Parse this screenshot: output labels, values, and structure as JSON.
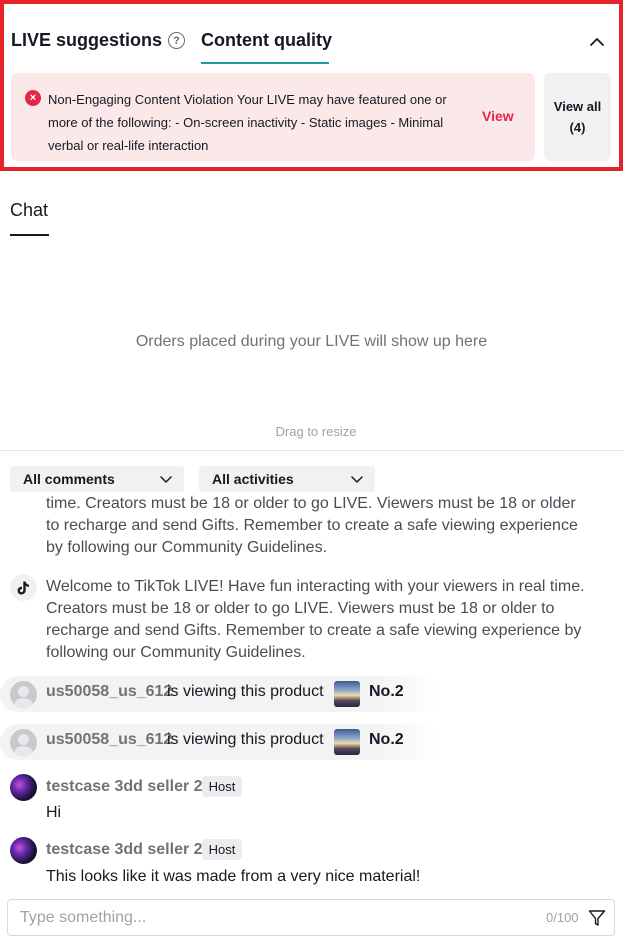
{
  "top_panel": {
    "tabs": [
      {
        "label": "LIVE suggestions",
        "help_icon": "question-circle-icon"
      },
      {
        "label": "Content quality",
        "active": true
      }
    ],
    "help_glyph": "?",
    "accent_color": "#1a9a9c",
    "highlight_color": "#e3242b",
    "violation": {
      "icon": "error-circle-icon",
      "icon_glyph": "×",
      "text": "Non-Engaging Content Violation Your LIVE may have featured one or more of the following: - On-screen inactivity - Static images - Minimal verbal or real-life interaction",
      "action_label": "View",
      "background": "#fbe9ea",
      "accent": "#e5264a"
    },
    "view_all": {
      "label": "View all",
      "count": "(4)"
    }
  },
  "chat": {
    "tab_label": "Chat",
    "empty_orders_text": "Orders placed during your LIVE will show up here",
    "drag_label": "Drag to resize",
    "filters": {
      "comments": "All comments",
      "activities": "All activities"
    },
    "system_message_partial": "time. Creators must be 18 or older to go LIVE. Viewers must be 18 or older to recharge and send Gifts. Remember to create a safe viewing experience by following our Community Guidelines.",
    "system_message": "Welcome to TikTok LIVE! Have fun interacting with your viewers in real time. Creators must be 18 or older to go LIVE. Viewers must be 18 or older to recharge and send Gifts. Remember to create a safe viewing experience by following our Community Guidelines.",
    "product_views": [
      {
        "user": "us50058_us_612",
        "action": "is viewing this product",
        "product": "No.2"
      },
      {
        "user": "us50058_us_612",
        "action": "is viewing this product",
        "product": "No.2"
      }
    ],
    "host_messages": [
      {
        "user": "testcase 3dd seller 2",
        "badge": "Host",
        "text": "Hi"
      },
      {
        "user": "testcase 3dd seller 2",
        "badge": "Host",
        "text": "This looks like it was made from a very nice material!"
      }
    ],
    "input": {
      "placeholder": "Type something...",
      "value": "",
      "counter": "0/100",
      "send_icon": "send-icon"
    }
  }
}
